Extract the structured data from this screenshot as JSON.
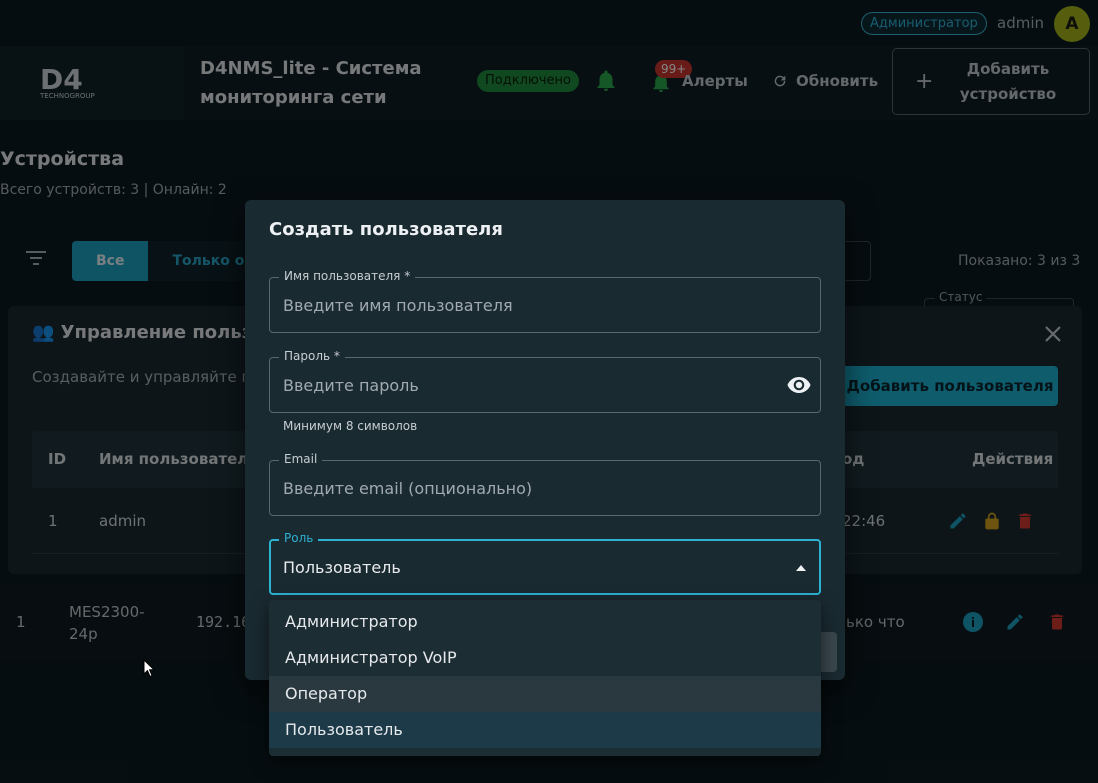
{
  "topbar": {
    "role_chip": "Администратор",
    "user_name": "admin",
    "avatar_letter": "A"
  },
  "header": {
    "logo_text": "D4",
    "logo_subtext": "TECHNOGROUP",
    "app_title": "D4NMS_lite - Система мониторинга сети",
    "connection_badge": "Подключено",
    "alerts_badge": "99+",
    "alerts_label": "Алерты",
    "refresh_label": "Обновить",
    "add_device_label": "Добавить устройство"
  },
  "devices_page": {
    "title": "Устройства",
    "subtitle": "Всего устройств: 3 | Онлайн: 2",
    "filter_all": "Все",
    "filter_offline": "Только оф",
    "shown_count": "Показано: 3 из 3",
    "status_label": "Статус",
    "row": {
      "id": "1",
      "name": "MES2300-24p",
      "ip": "192.16",
      "last_seen": "ько что"
    }
  },
  "user_panel": {
    "title": "👥 Управление пользов",
    "subtitle": "Создавайте и управляйте поль",
    "add_button": "Добавить пользователя",
    "columns": {
      "id": "ID",
      "username": "Имя пользователя",
      "last_login": "од",
      "actions": "Действия"
    },
    "rows": [
      {
        "id": "1",
        "username": "admin",
        "last_login": "22:46"
      }
    ]
  },
  "dialog": {
    "title": "Создать пользователя",
    "username": {
      "label": "Имя пользователя *",
      "placeholder": "Введите имя пользователя",
      "value": ""
    },
    "password": {
      "label": "Пароль *",
      "placeholder": "Введите пароль",
      "value": "",
      "helper": "Минимум 8 символов"
    },
    "email": {
      "label": "Email",
      "placeholder": "Введите email (опционально)",
      "value": ""
    },
    "role": {
      "label": "Роль",
      "value": "Пользователь",
      "options": [
        "Администратор",
        "Администратор VoIP",
        "Оператор",
        "Пользователь"
      ],
      "hovered": "Оператор"
    }
  },
  "colors": {
    "accent": "#1bb0cf",
    "online_green": "#1f8a3c",
    "alert_red": "#c9372c",
    "avatar": "#a5b51b",
    "panel_bg": "#1a2a31"
  },
  "icons": [
    "bell-icon",
    "refresh-icon",
    "plus-icon",
    "filter-icon",
    "close-icon",
    "edit-icon",
    "lock-icon",
    "trash-icon",
    "info-icon",
    "eye-icon",
    "caret-up-icon",
    "mouse-cursor"
  ]
}
